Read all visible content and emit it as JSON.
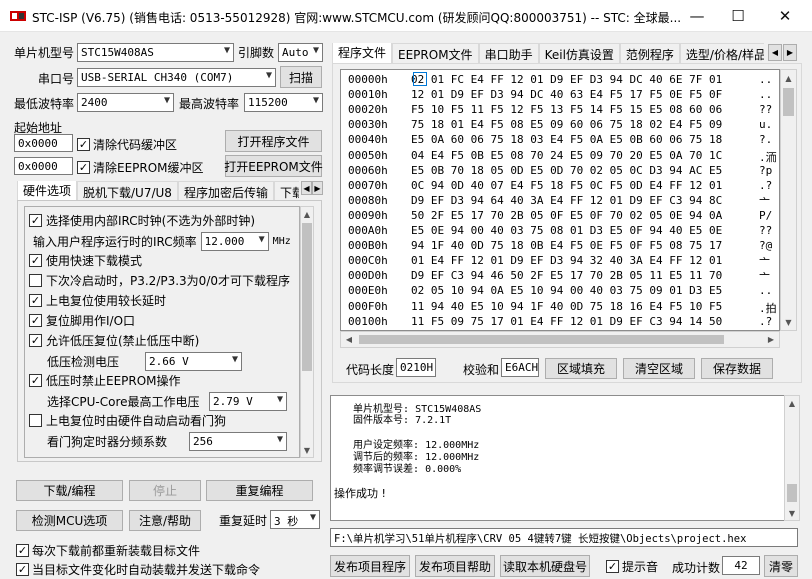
{
  "window": {
    "title": "STC-ISP (V6.75) (销售电话: 0513-55012928) 官网:www.STCMCU.com  (研发顾问QQ:800003751)  -- STC: 全球最...",
    "minimize": "—",
    "maximize": "☐",
    "close": "✕"
  },
  "left": {
    "mcu_label": "单片机型号",
    "mcu_value": "STC15W408AS",
    "pin_label": "引脚数",
    "pin_value": "Auto",
    "port_label": "串口号",
    "port_value": "USB-SERIAL CH340 (COM7)",
    "scan_label": "扫描",
    "min_baud_label": "最低波特率",
    "min_baud_value": "2400",
    "max_baud_label": "最高波特率",
    "max_baud_value": "115200",
    "start_addr_label": "起始地址",
    "addr1_value": "0x0000",
    "clear_code_label": "清除代码缓冲区",
    "open_prog_label": "打开程序文件",
    "addr2_value": "0x0000",
    "clear_eeprom_label": "清除EEPROM缓冲区",
    "open_eeprom_label": "打开EEPROM文件"
  },
  "hw_tabs": [
    "硬件选项",
    "脱机下载/U7/U8",
    "程序加密后传输",
    "下载"
  ],
  "hw_options": {
    "irc": "选择使用内部IRC时钟(不选为外部时钟)",
    "irc_freq_label": "输入用户程序运行时的IRC频率",
    "irc_freq_value": "12.000",
    "irc_unit": "MHz",
    "fast_download": "使用快速下载模式",
    "next_cold_start": "下次冷启动时，P3.2/P3.3为0/0才可下载程序",
    "long_delay": "上电复位使用较长延时",
    "reset_pin_io": "复位脚用作I/O口",
    "low_volt_reset": "允许低压复位(禁止低压中断)",
    "low_volt_detect_label": "低压检测电压",
    "low_volt_detect_value": "2.66 V",
    "no_eeprom_low_volt": "低压时禁止EEPROM操作",
    "cpu_core_label": "选择CPU-Core最高工作电压",
    "cpu_core_value": "2.79 V",
    "watchdog_auto": "上电复位时由硬件自动启动看门狗",
    "watchdog_div_label": "看门狗定时器分频系数",
    "watchdog_div_value": "256"
  },
  "bottom_left": {
    "download_label": "下载/编程",
    "stop_label": "停止",
    "reprogram_label": "重复编程",
    "detect_label": "检测MCU选项",
    "help_label": "注意/帮助",
    "repeat_delay_label": "重复延时",
    "repeat_delay_value": "3 秒",
    "reload_each_label": "每次下载前都重新装载目标文件",
    "auto_reload_label": "当目标文件变化时自动装载并发送下载命令"
  },
  "right_tabs": [
    "程序文件",
    "EEPROM文件",
    "串口助手",
    "Keil仿真设置",
    "范例程序",
    "选型/价格/样品"
  ],
  "hex_rows": [
    {
      "addr": "00000h",
      "bytes": "02 01 FC E4 FF 12 01 D9 EF D3 94 DC 40 6E 7F 01",
      "ascii": ".."
    },
    {
      "addr": "00010h",
      "bytes": "12 01 D9 EF D3 94 DC 40 63 E4 F5 17 F5 0E F5 0F",
      "ascii": ".."
    },
    {
      "addr": "00020h",
      "bytes": "F5 10 F5 11 F5 12 F5 13 F5 14 F5 15 E5 08 60 06",
      "ascii": "??"
    },
    {
      "addr": "00030h",
      "bytes": "75 18 01 E4 F5 08 E5 09 60 06 75 18 02 E4 F5 09",
      "ascii": "u."
    },
    {
      "addr": "00040h",
      "bytes": "E5 0A 60 06 75 18 03 E4 F5 0A E5 0B 60 06 75 18",
      "ascii": "?."
    },
    {
      "addr": "00050h",
      "bytes": "04 E4 F5 0B E5 08 70 24 E5 09 70 20 E5 0A 70 1C",
      "ascii": ".洏"
    },
    {
      "addr": "00060h",
      "bytes": "E5 0B 70 18 05 0D E5 0D 70 02 05 0C D3 94 AC E5",
      "ascii": "?p"
    },
    {
      "addr": "00070h",
      "bytes": "0C 94 0D 40 07 E4 F5 18 F5 0C F5 0D E4 FF 12 01",
      "ascii": ".?"
    },
    {
      "addr": "00080h",
      "bytes": "D9 EF D3 94 64 40 3A E4 FF 12 01 D9 EF C3 94 8C",
      "ascii": "亠"
    },
    {
      "addr": "00090h",
      "bytes": "50 2F E5 17 70 2B 05 0F E5 0F 70 02 05 0E 94 0A",
      "ascii": "P/"
    },
    {
      "addr": "000A0h",
      "bytes": "E5 0E 94 00 40 03 75 08 01 D3 E5 0F 94 40 E5 0E",
      "ascii": "??"
    },
    {
      "addr": "000B0h",
      "bytes": "94 1F 40 0D 75 18 0B E4 F5 0E F5 0F F5 08 75 17",
      "ascii": "?@"
    },
    {
      "addr": "000C0h",
      "bytes": "01 E4 FF 12 01 D9 EF D3 94 32 40 3A E4 FF 12 01",
      "ascii": "亠"
    },
    {
      "addr": "000D0h",
      "bytes": "D9 EF C3 94 46 50 2F E5 17 70 2B 05 11 E5 11 70",
      "ascii": "亠"
    },
    {
      "addr": "000E0h",
      "bytes": "02 05 10 94 0A E5 10 94 00 40 03 75 09 01 D3 E5",
      "ascii": ".."
    },
    {
      "addr": "000F0h",
      "bytes": "11 94 40 E5 10 94 1F 40 0D 75 18 16 E4 F5 10 F5",
      "ascii": ".拍"
    },
    {
      "addr": "00100h",
      "bytes": "11 F5 09 75 17 01 E4 FF 12 01 D9 EF C3 94 14 50",
      "ascii": ".?"
    }
  ],
  "code_bar": {
    "code_len_label": "代码长度",
    "code_len_value": "0210H",
    "checksum_label": "校验和",
    "checksum_value": "E6ACH",
    "fill_label": "区域填充",
    "clear_label": "清空区域",
    "save_label": "保存数据"
  },
  "messages": {
    "line1": "  单片机型号: STC15W408AS",
    "line2": "  固件版本号: 7.2.1T",
    "line3": "  用户设定频率: 12.000MHz",
    "line4": "  调节后的频率: 12.000MHz",
    "line5": "  频率调节误差: 0.000%",
    "success": "操作成功 !"
  },
  "path_value": "F:\\单片机学习\\51单片机程序\\CRV 05   4键转7键   长短按键\\Objects\\project.hex",
  "bottom_right": {
    "publish_prog": "发布项目程序",
    "publish_help": "发布项目帮助",
    "read_disk": "读取本机硬盘号",
    "beep_label": "提示音",
    "count_label": "成功计数",
    "count_value": "42",
    "clear_label": "清零"
  },
  "colors": {
    "accent": "#0078d7",
    "title_bg": "#ffffff"
  }
}
